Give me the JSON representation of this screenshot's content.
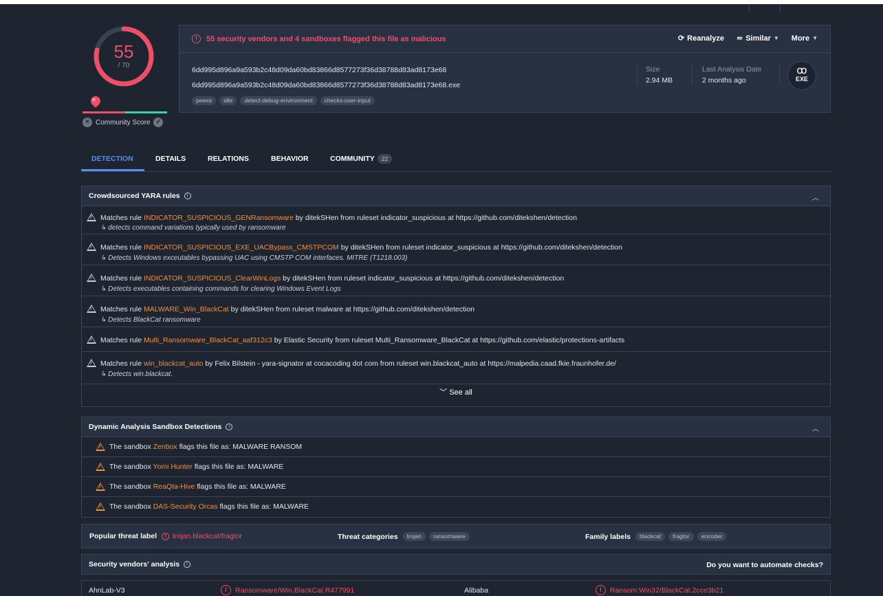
{
  "score": {
    "detected": "55",
    "total": "/ 70",
    "community_label": "Community Score"
  },
  "header": {
    "alert_text": "55 security vendors and 4 sandboxes flagged this file as malicious",
    "actions": {
      "reanalyze": "Reanalyze",
      "similar": "Similar",
      "more": "More"
    },
    "hash": "6dd995d896a9a593b2c48d09da60bd83866d8577273f36d38788d83ad8173e68",
    "filename": "6dd995d896a9a593b2c48d09da60bd83866d8577273f36d38788d83ad8173e68.exe",
    "tags": [
      "peexe",
      "idle",
      "detect-debug-environment",
      "checks-user-input"
    ],
    "size_label": "Size",
    "size_value": "2.94 MB",
    "last_analysis_label": "Last Analysis Date",
    "last_analysis_value": "2 months ago",
    "file_type": "EXE"
  },
  "tabs": {
    "detection": "DETECTION",
    "details": "DETAILS",
    "relations": "RELATIONS",
    "behavior": "BEHAVIOR",
    "community": "COMMUNITY",
    "community_count": "22"
  },
  "yara": {
    "title": "Crowdsourced YARA rules",
    "rows": [
      {
        "prefix": "Matches rule ",
        "rule": "INDICATOR_SUSPICIOUS_GENRansomware",
        "suffix": " by ditekSHen from ruleset indicator_suspicious at https://github.com/ditekshen/detection",
        "desc": "detects command variations typically used by ransomware"
      },
      {
        "prefix": "Matches rule ",
        "rule": "INDICATOR_SUSPICIOUS_EXE_UACBypass_CMSTPCOM",
        "suffix": " by ditekSHen from ruleset indicator_suspicious at https://github.com/ditekshen/detection",
        "desc": "Detects Windows exceutables bypassing UAC using CMSTP COM interfaces. MITRE (T1218.003)"
      },
      {
        "prefix": "Matches rule ",
        "rule": "INDICATOR_SUSPICIOUS_ClearWinLogs",
        "suffix": " by ditekSHen from ruleset indicator_suspicious at https://github.com/ditekshen/detection",
        "desc": "Detects executables containing commands for clearing Windows Event Logs"
      },
      {
        "prefix": "Matches rule ",
        "rule": "MALWARE_Win_BlackCat",
        "suffix": " by ditekSHen from ruleset malware at https://github.com/ditekshen/detection",
        "desc": "Detects BlackCat ransomware"
      },
      {
        "prefix": "Matches rule ",
        "rule": "Multi_Ransomware_BlackCat_aaf312c3",
        "suffix": " by Elastic Security from ruleset Multi_Ransomware_BlackCat at https://github.com/elastic/protections-artifacts",
        "desc": ""
      },
      {
        "prefix": "Matches rule ",
        "rule": "win_blackcat_auto",
        "suffix": " by Felix Bilstein - yara-signator at cocacoding dot com from ruleset win.blackcat_auto at https://malpedia.caad.fkie.fraunhofer.de/",
        "desc": "Detects win.blackcat."
      }
    ],
    "see_all": "See all"
  },
  "sandbox": {
    "title": "Dynamic Analysis Sandbox Detections",
    "rows": [
      {
        "prefix": "The sandbox ",
        "name": "Zenbox",
        "suffix": " flags this file as: MALWARE RANSOM"
      },
      {
        "prefix": "The sandbox ",
        "name": "Yomi Hunter",
        "suffix": " flags this file as: MALWARE"
      },
      {
        "prefix": "The sandbox ",
        "name": "ReaQta-Hive",
        "suffix": " flags this file as: MALWARE"
      },
      {
        "prefix": "The sandbox ",
        "name": "DAS-Security Orcas",
        "suffix": " flags this file as: MALWARE"
      }
    ]
  },
  "threat": {
    "popular_label": "Popular threat label",
    "popular_value": "trojan.blackcat/fragtor",
    "categories_label": "Threat categories",
    "categories": [
      "trojan",
      "ransomware"
    ],
    "family_label": "Family labels",
    "families": [
      "blackcat",
      "fragtor",
      "encoder"
    ]
  },
  "vendors": {
    "title": "Security vendors' analysis",
    "automate": "Do you want to automate checks?",
    "rows": [
      {
        "vendor1": "AhnLab-V3",
        "result1": "Ransomware/Win.BlackCat.R477991",
        "vendor2": "Alibaba",
        "result2": "Ransom:Win32/BlackCat.2cce3b21"
      }
    ]
  },
  "colors": {
    "malicious": "#ef4f66",
    "accent": "#5b8def",
    "rule": "#f0913a",
    "clean": "#3fd2a0"
  }
}
